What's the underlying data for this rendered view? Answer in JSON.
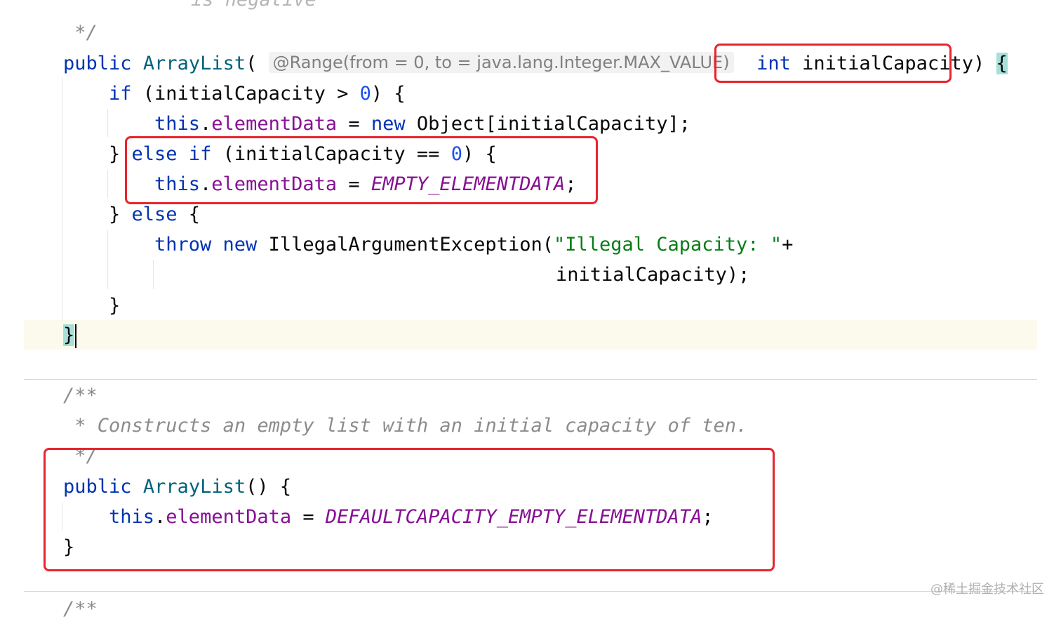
{
  "code": {
    "top_comment_fragment": "is negative",
    "comment_end_1": " */",
    "line_ctor": {
      "public_kw": "public",
      "name": "ArrayList",
      "paren_open": "(",
      "hint": "@Range(from = 0, to = java.lang.Integer.MAX_VALUE)",
      "int_kw": "int",
      "param": "initialCapacity",
      "paren_close": ")",
      "brace": "{"
    },
    "line_if": {
      "kw": "if",
      "cond_a": " (initialCapacity > ",
      "num": "0",
      "cond_b": ") {"
    },
    "line_assign1": {
      "this_kw": "this",
      "dot": ".",
      "field": "elementData",
      "eq": " = ",
      "new_kw": "new",
      "rest": " Object[initialCapacity];"
    },
    "line_elseif": {
      "brace": "} ",
      "else_kw": "else",
      "if_kw": "if",
      "cond_a": " (initialCapacity == ",
      "num": "0",
      "cond_b": ") {"
    },
    "line_assign2": {
      "this_kw": "this",
      "dot": ".",
      "field": "elementData",
      "eq": " = ",
      "const": "EMPTY_ELEMENTDATA",
      "semi": ";"
    },
    "line_else": {
      "brace": "} ",
      "else_kw": "else",
      "rest": " {"
    },
    "line_throw": {
      "throw_kw": "throw",
      "new_kw": "new",
      "cls": " IllegalArgumentException(",
      "str": "\"Illegal Capacity: \"",
      "plus": "+"
    },
    "line_throw_cont": "initialCapacity);",
    "line_close_if": "}",
    "line_close_ctor": "}",
    "doc_open": "/**",
    "doc_text": " * Constructs an empty list with an initial capacity of ten.",
    "doc_close": " */",
    "line_ctor2": {
      "public_kw": "public",
      "name": "ArrayList",
      "rest": "() {"
    },
    "line_assign3": {
      "this_kw": "this",
      "dot": ".",
      "field": "elementData",
      "eq": " = ",
      "const": "DEFAULTCAPACITY_EMPTY_ELEMENTDATA",
      "semi": ";"
    },
    "line_close_ctor2": "}",
    "doc_open_2": "/**"
  },
  "watermark": "@稀土掘金技术社区",
  "colors": {
    "keyword": "#0033b3",
    "method": "#00627a",
    "field": "#871094",
    "number": "#1750eb",
    "string": "#067d17",
    "comment": "#8c8c8c",
    "annotation_box": "#e8242c"
  }
}
